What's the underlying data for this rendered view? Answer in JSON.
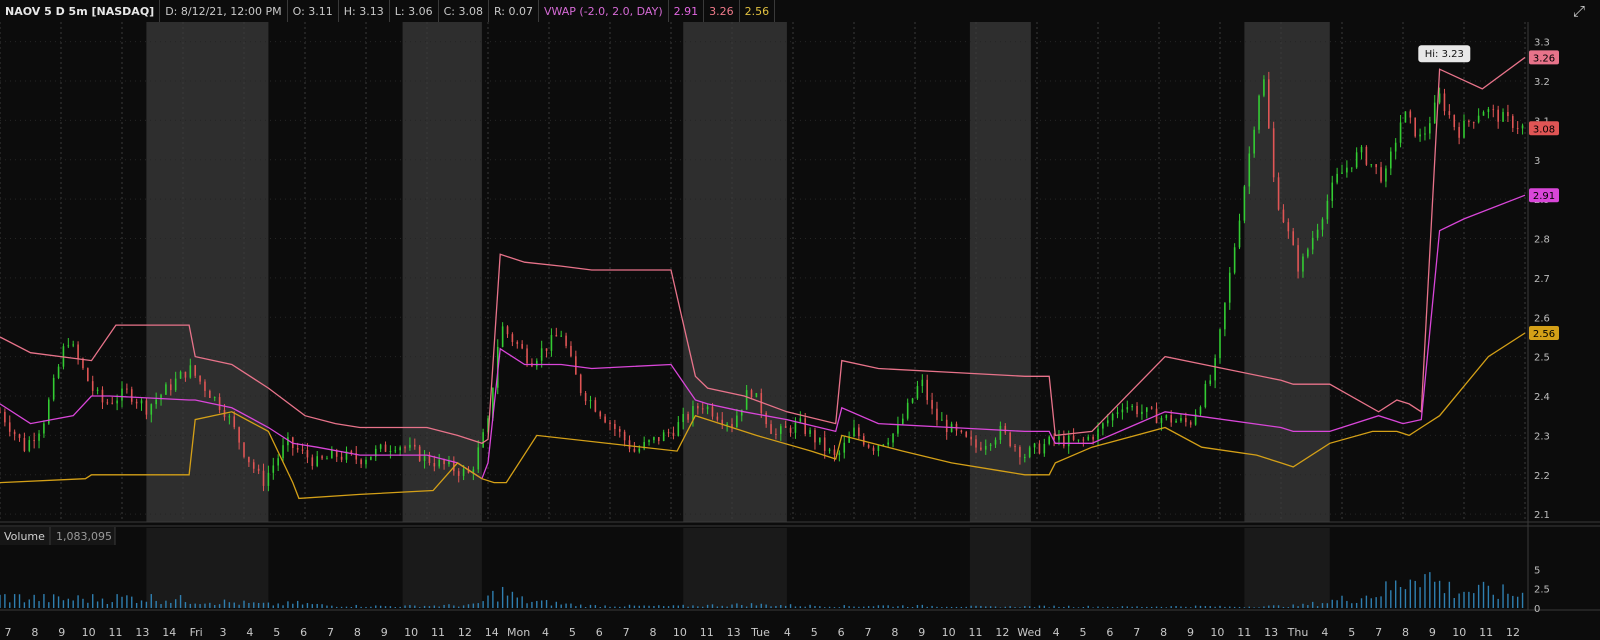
{
  "header": {
    "symbol": "NAOV 5 D 5m [NASDAQ]",
    "date": "D: 8/12/21, 12:00 PM",
    "open": "O: 3.11",
    "high": "H: 3.13",
    "low": "L: 3.06",
    "close": "C: 3.08",
    "range": "R: 0.07",
    "study_name": "VWAP (-2.0, 2.0, DAY)",
    "vwap_value": "2.91",
    "upper_band_value": "3.26",
    "lower_band_value": "2.56"
  },
  "toolbar": {
    "expand_icon": "expand-icon"
  },
  "colors": {
    "background": "#0c0c0c",
    "extended_hours_shade": "#2e2e2e",
    "vwap": "#d946d9",
    "upper_band": "#e8738a",
    "lower_band": "#d4a017",
    "up_candle": "#33cc33",
    "down_candle": "#e05555",
    "volume": "#2f7fb0"
  },
  "price_axis": {
    "ticks": [
      "3.3",
      "3.2",
      "3.1",
      "3",
      "2.9",
      "2.8",
      "2.7",
      "2.6",
      "2.5",
      "2.4",
      "2.3",
      "2.2",
      "2.1"
    ],
    "tags": {
      "upper": "3.26",
      "close": "3.08",
      "vwap": "2.91",
      "lower": "2.56"
    }
  },
  "hi_label": "Hi: 3.23",
  "volume_panel": {
    "label": "Volume",
    "value": "1,083,095",
    "ticks": [
      "5",
      "2.5",
      "0"
    ]
  },
  "time_axis": {
    "labels": [
      "7",
      "8",
      "9",
      "10",
      "11",
      "13",
      "14",
      "Fri",
      "3",
      "4",
      "5",
      "6",
      "7",
      "8",
      "9",
      "10",
      "11",
      "12",
      "14",
      "Mon",
      "4",
      "5",
      "6",
      "7",
      "8",
      "10",
      "11",
      "13",
      "Tue",
      "4",
      "5",
      "6",
      "7",
      "8",
      "9",
      "10",
      "11",
      "12",
      "Wed",
      "4",
      "5",
      "6",
      "7",
      "8",
      "9",
      "10",
      "11",
      "13",
      "Thu",
      "4",
      "5",
      "7",
      "8",
      "9",
      "10",
      "11",
      "12"
    ]
  },
  "chart_data": {
    "type": "line",
    "title": "NAOV 5 D 5m [NASDAQ]",
    "ylim": [
      2.08,
      3.35
    ],
    "x_range": [
      "Fri 7:00",
      "Thu 12:00"
    ],
    "series": [
      {
        "name": "price",
        "x": [
          0.0,
          0.2,
          0.35,
          0.55,
          0.75,
          0.85,
          1.05,
          1.2,
          1.55,
          1.85,
          2.0,
          2.15,
          2.35,
          2.6,
          2.75,
          2.95,
          3.25,
          3.5,
          3.85,
          4.0,
          4.1,
          4.35,
          4.6,
          4.75,
          4.95,
          5.2,
          5.5,
          5.75,
          6.0,
          6.15,
          6.35,
          6.55,
          6.85,
          7.0,
          7.15,
          7.35,
          7.55,
          7.65,
          7.85,
          8.0,
          8.2,
          8.4,
          8.65,
          8.85,
          9.0,
          9.2,
          9.45,
          9.75,
          9.95,
          10.15,
          10.35,
          10.45,
          10.65,
          10.95,
          11.15,
          11.35,
          11.5,
          11.65,
          11.8,
          11.95,
          12.15,
          12.35,
          12.5
        ],
        "values": [
          2.36,
          2.27,
          2.33,
          2.55,
          2.42,
          2.38,
          2.41,
          2.37,
          2.47,
          2.36,
          2.26,
          2.18,
          2.28,
          2.23,
          2.25,
          2.24,
          2.28,
          2.24,
          2.2,
          2.33,
          2.58,
          2.49,
          2.56,
          2.42,
          2.35,
          2.26,
          2.31,
          2.38,
          2.33,
          2.42,
          2.3,
          2.33,
          2.24,
          2.31,
          2.27,
          2.31,
          2.44,
          2.35,
          2.3,
          2.27,
          2.31,
          2.25,
          2.29,
          2.28,
          2.31,
          2.38,
          2.35,
          2.33,
          2.46,
          2.84,
          3.23,
          2.92,
          2.72,
          2.95,
          3.02,
          2.95,
          3.12,
          3.05,
          3.16,
          3.07,
          3.13,
          3.1,
          3.08
        ]
      },
      {
        "name": "upper band",
        "x": [
          0.0,
          0.25,
          0.75,
          0.95,
          1.55,
          1.6,
          1.9,
          2.2,
          2.5,
          2.75,
          2.95,
          3.5,
          3.75,
          3.95,
          4.0,
          4.1,
          4.3,
          4.6,
          4.85,
          5.5,
          5.7,
          5.8,
          6.1,
          6.45,
          6.85,
          6.9,
          7.2,
          7.8,
          8.4,
          8.6,
          8.65,
          8.95,
          9.55,
          10.5,
          10.6,
          10.9,
          11.3,
          11.45,
          11.55,
          11.65,
          11.8,
          12.15,
          12.5
        ],
        "values": [
          2.55,
          2.51,
          2.49,
          2.58,
          2.58,
          2.5,
          2.48,
          2.42,
          2.35,
          2.33,
          2.32,
          2.32,
          2.3,
          2.28,
          2.29,
          2.76,
          2.74,
          2.73,
          2.72,
          2.72,
          2.45,
          2.42,
          2.4,
          2.36,
          2.33,
          2.49,
          2.47,
          2.46,
          2.45,
          2.45,
          2.3,
          2.31,
          2.5,
          2.44,
          2.43,
          2.43,
          2.36,
          2.39,
          2.38,
          2.36,
          3.23,
          3.18,
          3.26
        ]
      },
      {
        "name": "VWAP",
        "x": [
          0.0,
          0.25,
          0.6,
          0.75,
          0.9,
          1.55,
          1.6,
          1.9,
          2.2,
          2.4,
          2.6,
          2.95,
          3.5,
          3.75,
          3.95,
          4.0,
          4.1,
          4.3,
          4.6,
          4.85,
          5.5,
          5.7,
          5.8,
          6.1,
          6.45,
          6.85,
          6.9,
          7.2,
          7.8,
          8.4,
          8.6,
          8.65,
          8.95,
          9.55,
          9.8,
          10.5,
          10.6,
          10.9,
          11.3,
          11.5,
          11.65,
          11.8,
          12.0,
          12.5
        ],
        "values": [
          2.38,
          2.33,
          2.35,
          2.4,
          2.4,
          2.39,
          2.39,
          2.37,
          2.32,
          2.28,
          2.27,
          2.25,
          2.25,
          2.23,
          2.19,
          2.23,
          2.52,
          2.48,
          2.48,
          2.47,
          2.48,
          2.39,
          2.38,
          2.36,
          2.34,
          2.31,
          2.37,
          2.33,
          2.32,
          2.31,
          2.31,
          2.28,
          2.28,
          2.36,
          2.35,
          2.32,
          2.31,
          2.31,
          2.35,
          2.33,
          2.34,
          2.82,
          2.85,
          2.91
        ]
      },
      {
        "name": "lower band",
        "x": [
          0.0,
          0.7,
          0.75,
          1.55,
          1.6,
          1.9,
          2.2,
          2.4,
          2.45,
          2.95,
          3.55,
          3.75,
          3.95,
          4.05,
          4.15,
          4.4,
          5.55,
          5.7,
          5.8,
          6.2,
          6.65,
          6.85,
          6.9,
          7.4,
          7.8,
          8.2,
          8.4,
          8.6,
          8.65,
          8.95,
          9.55,
          9.85,
          10.3,
          10.5,
          10.6,
          10.9,
          11.25,
          11.45,
          11.55,
          11.65,
          11.8,
          12.2,
          12.5
        ],
        "values": [
          2.18,
          2.19,
          2.2,
          2.2,
          2.34,
          2.36,
          2.31,
          2.18,
          2.14,
          2.15,
          2.16,
          2.23,
          2.19,
          2.18,
          2.18,
          2.3,
          2.26,
          2.35,
          2.34,
          2.3,
          2.26,
          2.24,
          2.3,
          2.26,
          2.23,
          2.21,
          2.2,
          2.2,
          2.23,
          2.27,
          2.32,
          2.27,
          2.25,
          2.23,
          2.22,
          2.28,
          2.31,
          2.31,
          2.3,
          2.32,
          2.35,
          2.5,
          2.56
        ]
      }
    ],
    "volume": {
      "unit": "100K",
      "x": [
        0.0,
        0.5,
        1.15,
        2.2,
        2.45,
        2.7,
        3.25,
        3.9,
        4.1,
        4.3,
        4.8,
        5.5,
        6.15,
        6.55,
        7.0,
        7.2,
        7.85,
        8.1,
        8.7,
        9.15,
        9.85,
        10.1,
        10.65,
        10.8,
        11.2,
        11.35,
        11.5,
        11.55,
        11.6,
        11.75,
        11.9,
        12.2,
        12.45
      ],
      "values": [
        1.9,
        1.5,
        1.8,
        0.6,
        0.8,
        0.4,
        0.3,
        0.5,
        2.9,
        1.2,
        0.4,
        0.3,
        0.6,
        0.4,
        0.3,
        0.4,
        0.3,
        0.2,
        0.3,
        0.2,
        0.3,
        0.2,
        0.4,
        0.8,
        2.1,
        3.0,
        4.2,
        5.8,
        7.4,
        4.6,
        3.1,
        2.8,
        2.3
      ]
    }
  }
}
